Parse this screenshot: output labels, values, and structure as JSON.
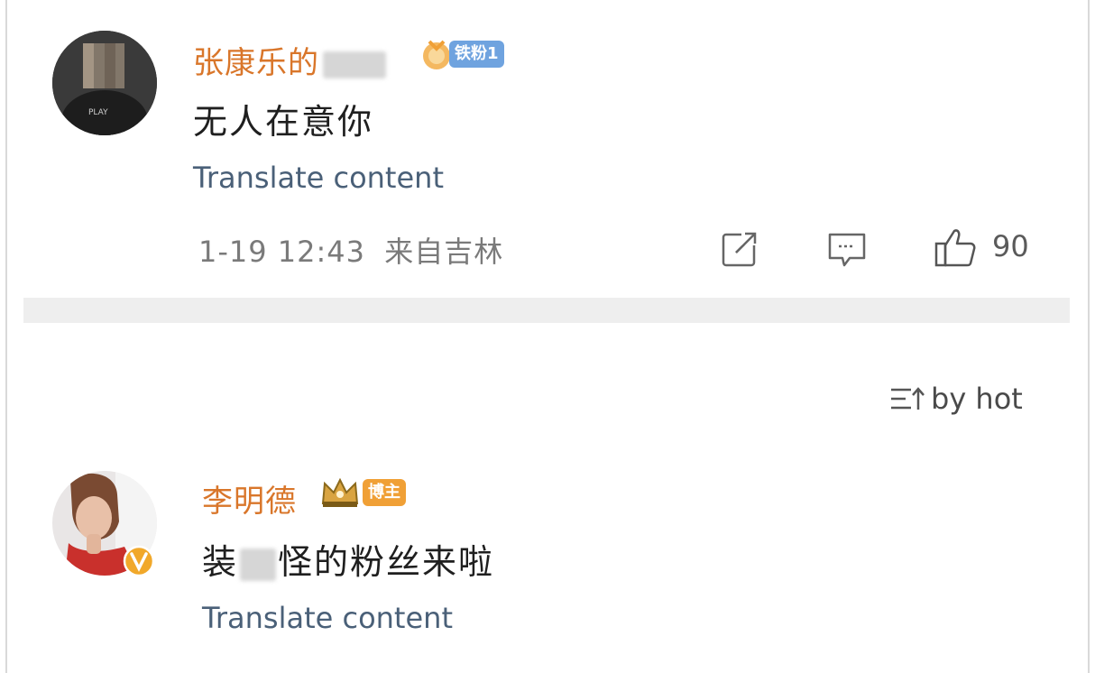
{
  "comments": [
    {
      "username": "张康乐的",
      "badge": "铁粉1",
      "text": "无人在意你",
      "translate": "Translate content",
      "timestamp": "1-19 12:43",
      "location": "来自吉林",
      "likes": "90"
    },
    {
      "username": "李明德",
      "badge": "博主",
      "text_before": "装",
      "text_after": "怪的粉丝来啦",
      "translate": "Translate content"
    }
  ],
  "sort": {
    "label": "by hot"
  },
  "icons": {
    "share": "share-icon",
    "comment": "comment-icon",
    "like": "thumbs-up-icon",
    "sort": "sort-icon",
    "crown": "crown-icon",
    "verified": "verified-badge-icon"
  },
  "colors": {
    "username": "#d9762a",
    "translate": "#4a6078",
    "fan_badge": "#6fa3df",
    "author_badge": "#f0a036"
  }
}
